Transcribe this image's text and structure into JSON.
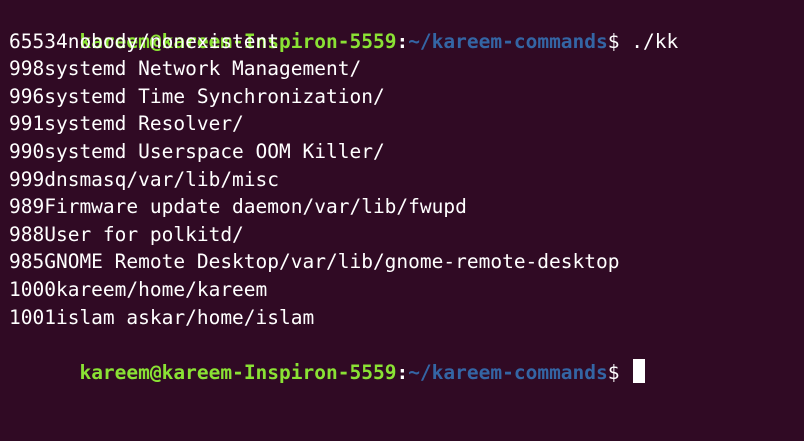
{
  "terminal": {
    "prompt": {
      "user_host": "kareem@kareem-Inspiron-5559",
      "separator": ":",
      "path": "~/kareem-commands",
      "symbol": "$"
    },
    "command": " ./kk",
    "output": [
      "65534nobody/nonexistent",
      "998systemd Network Management/",
      "996systemd Time Synchronization/",
      "991systemd Resolver/",
      "990systemd Userspace OOM Killer/",
      "999dnsmasq/var/lib/misc",
      "989Firmware update daemon/var/lib/fwupd",
      "988User for polkitd/",
      "985GNOME Remote Desktop/var/lib/gnome-remote-desktop",
      "1000kareem/home/kareem",
      "1001islam askar/home/islam"
    ],
    "colors": {
      "background": "#300a24",
      "user_host": "#8ae234",
      "path": "#3465a4",
      "text": "#ffffff"
    }
  }
}
